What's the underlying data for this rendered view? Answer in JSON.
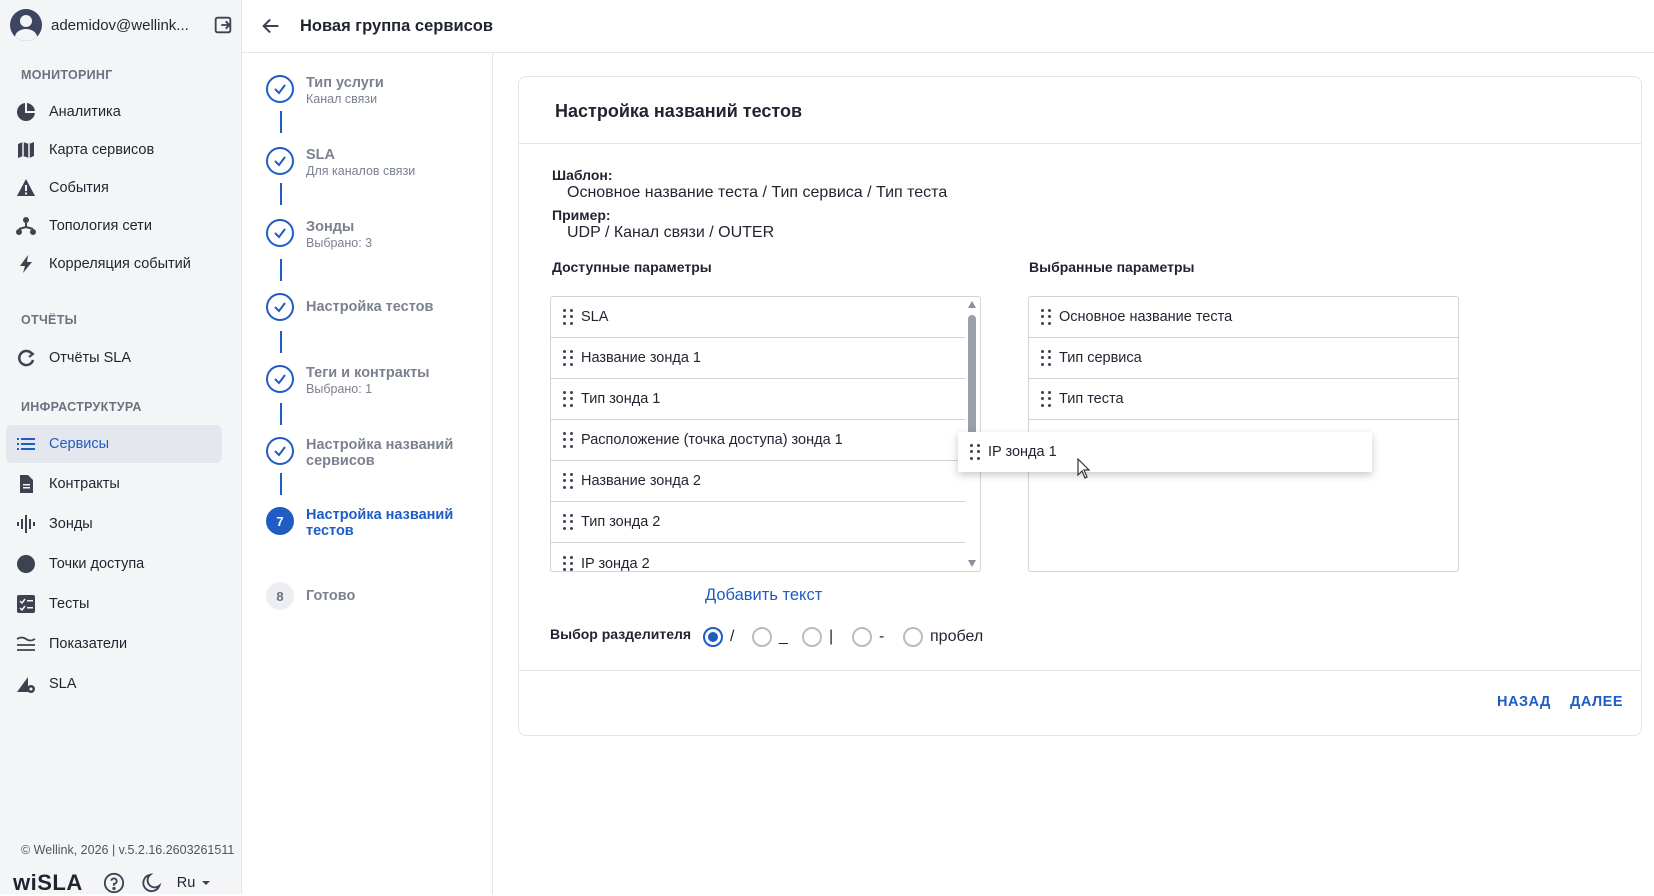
{
  "user": {
    "name": "ademidov@wellink..."
  },
  "sidebar": {
    "sections": {
      "monitoring": "МОНИТОРИНГ",
      "reports": "ОТЧЁТЫ",
      "infrastructure": "ИНФРАСТРУКТУРА"
    },
    "items": [
      {
        "label": "Аналитика",
        "icon": "pie-chart-icon"
      },
      {
        "label": "Карта сервисов",
        "icon": "map-icon"
      },
      {
        "label": "События",
        "icon": "warning-icon"
      },
      {
        "label": "Топология сети",
        "icon": "topology-icon"
      },
      {
        "label": "Корреляция событий",
        "icon": "lightning-icon"
      },
      {
        "label": "Отчёты SLA",
        "icon": "report-cycle-icon"
      },
      {
        "label": "Сервисы",
        "icon": "list-icon",
        "active": true
      },
      {
        "label": "Контракты",
        "icon": "document-icon"
      },
      {
        "label": "Зонды",
        "icon": "probe-wave-icon"
      },
      {
        "label": "Точки доступа",
        "icon": "circle-icon"
      },
      {
        "label": "Тесты",
        "icon": "checklist-icon"
      },
      {
        "label": "Показатели",
        "icon": "metrics-icon"
      },
      {
        "label": "SLA",
        "icon": "sla-gear-icon"
      }
    ],
    "footer": {
      "copyright": "© Wellink, 2026 | v.5.2.16.2603261511",
      "brand": "wiSLA",
      "language": "Ru"
    }
  },
  "header": {
    "title": "Новая группа сервисов"
  },
  "stepper": [
    {
      "number": "1",
      "title": "Тип услуги",
      "subtitle": "Канал связи",
      "state": "done"
    },
    {
      "number": "2",
      "title": "SLA",
      "subtitle": "Для каналов связи",
      "state": "done"
    },
    {
      "number": "3",
      "title": "Зонды",
      "subtitle": "Выбрано: 3",
      "state": "done"
    },
    {
      "number": "4",
      "title": "Настройка тестов",
      "subtitle": "",
      "state": "done"
    },
    {
      "number": "5",
      "title": "Теги и контракты",
      "subtitle": "Выбрано: 1",
      "state": "done"
    },
    {
      "number": "6",
      "title": "Настройка названий сервисов",
      "subtitle": "",
      "state": "done"
    },
    {
      "number": "7",
      "title": "Настройка названий тестов",
      "subtitle": "",
      "state": "current"
    },
    {
      "number": "8",
      "title": "Готово",
      "subtitle": "",
      "state": "pending"
    }
  ],
  "card": {
    "title": "Настройка названий тестов",
    "template_label": "Шаблон:",
    "template_value": "Основное название теста / Тип сервиса / Тип теста",
    "example_label": "Пример:",
    "example_value": "UDP / Канал связи / OUTER",
    "available_title": "Доступные параметры",
    "selected_title": "Выбранные параметры",
    "available_items": [
      "SLA",
      "Название зонда 1",
      "Тип зонда 1",
      "Расположение (точка доступа) зонда 1",
      "Название зонда 2",
      "Тип зонда 2",
      "IP зонда 2"
    ],
    "selected_items": [
      "Основное название теста",
      "Тип сервиса",
      "Тип теста"
    ],
    "dragging_item": "IP зонда 1",
    "add_text": "Добавить текст",
    "separator_label": "Выбор разделителя",
    "separators": [
      {
        "label": "/",
        "checked": true
      },
      {
        "label": "_",
        "checked": false
      },
      {
        "label": "|",
        "checked": false
      },
      {
        "label": "-",
        "checked": false
      },
      {
        "label": "пробел",
        "checked": false
      }
    ],
    "back_button": "НАЗАД",
    "next_button": "ДАЛЕЕ"
  },
  "colors": {
    "accent": "#1f5cc4",
    "sidebar_bg": "#f4f5f7",
    "muted": "#7b8190"
  }
}
